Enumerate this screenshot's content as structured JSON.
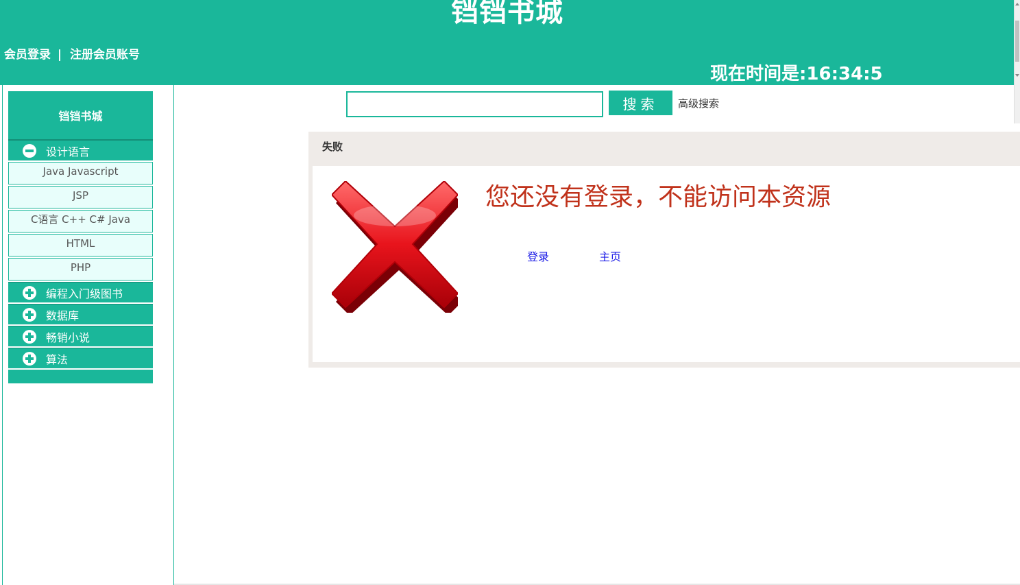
{
  "header": {
    "site_title": "铛铛书城",
    "login_link": "会员登录",
    "separator": "|",
    "register_link": "注册会员账号",
    "clock": "现在时间是:16:34:5"
  },
  "sidebar": {
    "title": "铛铛书城",
    "menus": [
      {
        "label": "设计语言",
        "expanded": true,
        "icon": "minus-circle-icon",
        "items": [
          "Java Javascript",
          "JSP",
          "C语言 C++ C# Java",
          "HTML",
          "PHP"
        ]
      },
      {
        "label": "编程入门级图书",
        "expanded": false,
        "icon": "plus-circle-icon"
      },
      {
        "label": "数据库",
        "expanded": false,
        "icon": "plus-circle-icon"
      },
      {
        "label": "畅销小说",
        "expanded": false,
        "icon": "plus-circle-icon"
      },
      {
        "label": "算法",
        "expanded": false,
        "icon": "plus-circle-icon"
      }
    ]
  },
  "search": {
    "input_value": "",
    "button_label": "搜索",
    "advanced_label": "高级搜索"
  },
  "message_panel": {
    "title": "失败",
    "icon": "red-x-icon",
    "message": "您还没有登录，不能访问本资源",
    "links": {
      "login": "登录",
      "home": "主页"
    }
  },
  "colors": {
    "brand": "#1ab79a",
    "submenu_bg": "#e8fefb",
    "error_text": "#c0321b",
    "link": "#1a1ae6",
    "panel_bg": "#efebe8"
  }
}
